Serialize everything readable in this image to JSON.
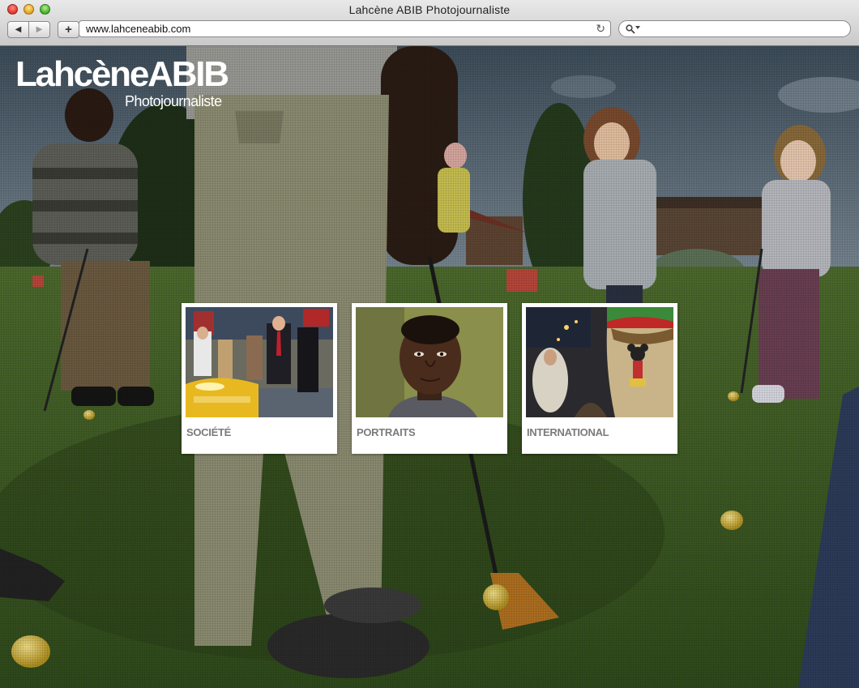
{
  "window": {
    "title": "Lahcène ABIB Photojournaliste"
  },
  "toolbar": {
    "back_icon": "◀",
    "forward_icon": "▶",
    "add_icon": "+",
    "url": "www.lahceneabib.com",
    "reload_icon": "↻",
    "search_icon": "🔍",
    "search_value": ""
  },
  "logo": {
    "name": "LahcèneABIB",
    "subtitle": "Photojournaliste"
  },
  "categories": [
    {
      "label": "SOCIÉTÉ"
    },
    {
      "label": "PORTRAITS"
    },
    {
      "label": "INTERNATIONAL"
    }
  ]
}
